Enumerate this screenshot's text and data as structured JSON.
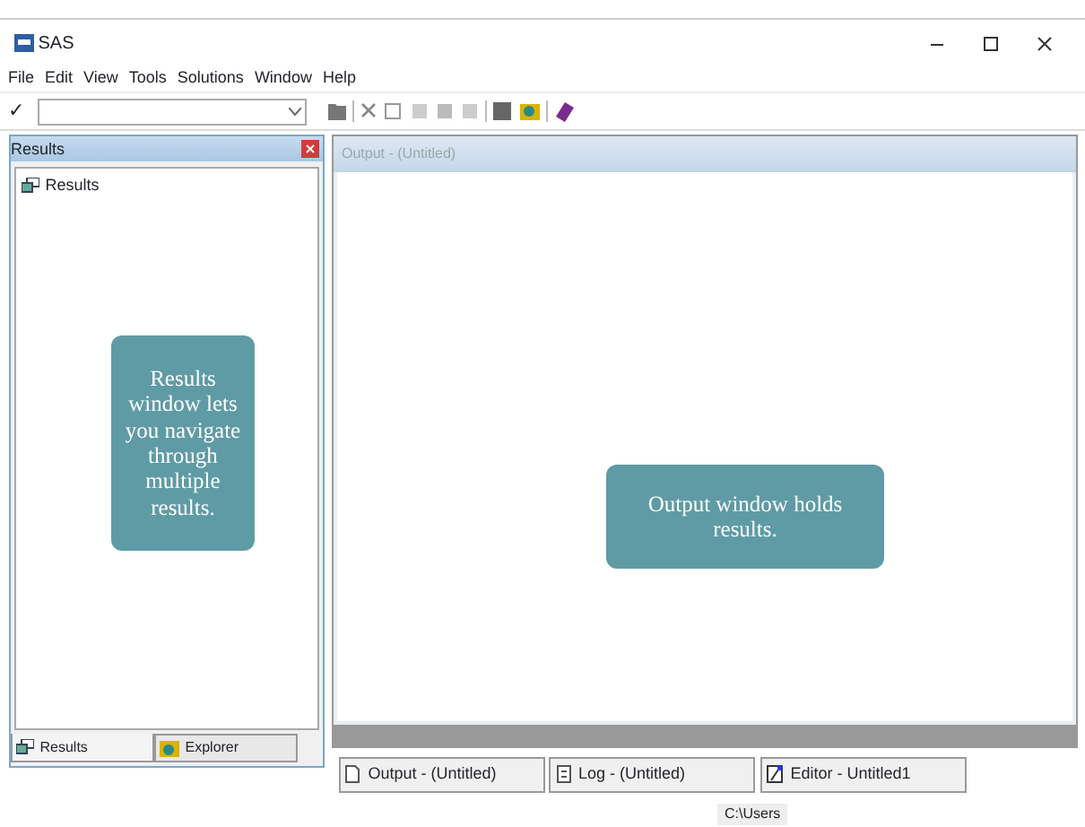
{
  "window": {
    "title": "SAS"
  },
  "menu": [
    "File",
    "Edit",
    "View",
    "Tools",
    "Solutions",
    "Window",
    "Help"
  ],
  "command_bar": {
    "check": "✓"
  },
  "results_pane": {
    "title": "Results",
    "tree": [
      {
        "label": "Results"
      }
    ],
    "tabs": [
      {
        "label": "Results",
        "selected": true
      },
      {
        "label": "Explorer",
        "selected": false
      }
    ]
  },
  "output_pane": {
    "title": "Output - (Untitled)"
  },
  "window_tabs": [
    {
      "label": "Output - (Untitled)",
      "kind": "output"
    },
    {
      "label": "Log - (Untitled)",
      "kind": "log"
    },
    {
      "label": "Editor - Untitled1",
      "kind": "editor"
    }
  ],
  "status_bar": {
    "path": "C:\\Users"
  },
  "callouts": [
    {
      "text": "Results window lets you navigate through multiple results."
    },
    {
      "text": "Output window holds results."
    }
  ]
}
